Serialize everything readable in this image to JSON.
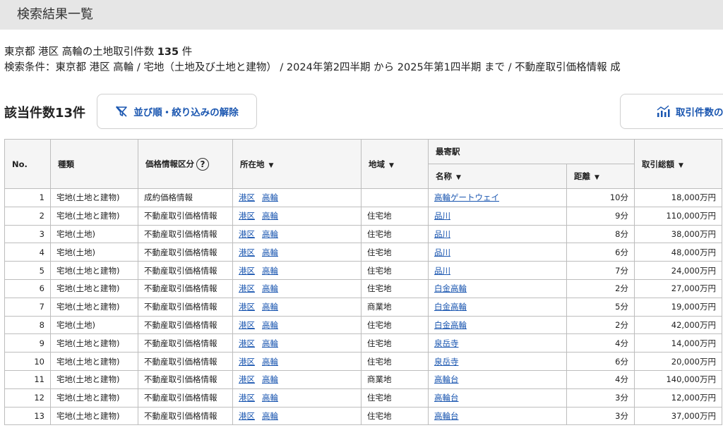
{
  "page": {
    "title": "検索結果一覧",
    "summary_prefix": "東京都 港区 高輪の土地取引件数",
    "summary_count": "135",
    "summary_suffix": "件",
    "criteria": "検索条件：東京都 港区 高輪 / 宅地（土地及び土地と建物） / 2024年第2四半期 から 2025年第1四半期 まで / 不動産取引価格情報 成"
  },
  "toolbar": {
    "count_label": "該当件数13件",
    "reset_label": "並び順・絞り込みの解除",
    "reset_icon": "filter-off-icon",
    "chart_label": "取引件数の",
    "chart_icon": "chart-icon",
    "accent_color": "#1a56b0"
  },
  "table": {
    "headers": {
      "no": "No.",
      "type": "種類",
      "price_class": "価格情報区分",
      "location": "所在地",
      "area": "地域",
      "station": "最寄駅",
      "station_name": "名称",
      "distance": "距離",
      "total": "取引総額",
      "sort_arrow": "▼",
      "help": "?"
    },
    "rows": [
      {
        "no": "1",
        "type": "宅地(土地と建物)",
        "price_class": "成約価格情報",
        "ward": "港区",
        "town": "高輪",
        "area": "",
        "station": "高輪ゲートウェイ",
        "distance": "10分",
        "total": "18,000万円"
      },
      {
        "no": "2",
        "type": "宅地(土地と建物)",
        "price_class": "不動産取引価格情報",
        "ward": "港区",
        "town": "高輪",
        "area": "住宅地",
        "station": "品川",
        "distance": "9分",
        "total": "110,000万円"
      },
      {
        "no": "3",
        "type": "宅地(土地)",
        "price_class": "不動産取引価格情報",
        "ward": "港区",
        "town": "高輪",
        "area": "住宅地",
        "station": "品川",
        "distance": "8分",
        "total": "38,000万円"
      },
      {
        "no": "4",
        "type": "宅地(土地)",
        "price_class": "不動産取引価格情報",
        "ward": "港区",
        "town": "高輪",
        "area": "住宅地",
        "station": "品川",
        "distance": "6分",
        "total": "48,000万円"
      },
      {
        "no": "5",
        "type": "宅地(土地と建物)",
        "price_class": "不動産取引価格情報",
        "ward": "港区",
        "town": "高輪",
        "area": "住宅地",
        "station": "品川",
        "distance": "7分",
        "total": "24,000万円"
      },
      {
        "no": "6",
        "type": "宅地(土地と建物)",
        "price_class": "不動産取引価格情報",
        "ward": "港区",
        "town": "高輪",
        "area": "住宅地",
        "station": "白金高輪",
        "distance": "2分",
        "total": "27,000万円"
      },
      {
        "no": "7",
        "type": "宅地(土地と建物)",
        "price_class": "不動産取引価格情報",
        "ward": "港区",
        "town": "高輪",
        "area": "商業地",
        "station": "白金高輪",
        "distance": "5分",
        "total": "19,000万円"
      },
      {
        "no": "8",
        "type": "宅地(土地)",
        "price_class": "不動産取引価格情報",
        "ward": "港区",
        "town": "高輪",
        "area": "住宅地",
        "station": "白金高輪",
        "distance": "2分",
        "total": "42,000万円"
      },
      {
        "no": "9",
        "type": "宅地(土地と建物)",
        "price_class": "不動産取引価格情報",
        "ward": "港区",
        "town": "高輪",
        "area": "住宅地",
        "station": "泉岳寺",
        "distance": "4分",
        "total": "14,000万円"
      },
      {
        "no": "10",
        "type": "宅地(土地と建物)",
        "price_class": "不動産取引価格情報",
        "ward": "港区",
        "town": "高輪",
        "area": "住宅地",
        "station": "泉岳寺",
        "distance": "6分",
        "total": "20,000万円"
      },
      {
        "no": "11",
        "type": "宅地(土地と建物)",
        "price_class": "不動産取引価格情報",
        "ward": "港区",
        "town": "高輪",
        "area": "商業地",
        "station": "高輪台",
        "distance": "4分",
        "total": "140,000万円"
      },
      {
        "no": "12",
        "type": "宅地(土地と建物)",
        "price_class": "不動産取引価格情報",
        "ward": "港区",
        "town": "高輪",
        "area": "住宅地",
        "station": "高輪台",
        "distance": "3分",
        "total": "12,000万円"
      },
      {
        "no": "13",
        "type": "宅地(土地と建物)",
        "price_class": "不動産取引価格情報",
        "ward": "港区",
        "town": "高輪",
        "area": "住宅地",
        "station": "高輪台",
        "distance": "3分",
        "total": "37,000万円"
      }
    ]
  }
}
